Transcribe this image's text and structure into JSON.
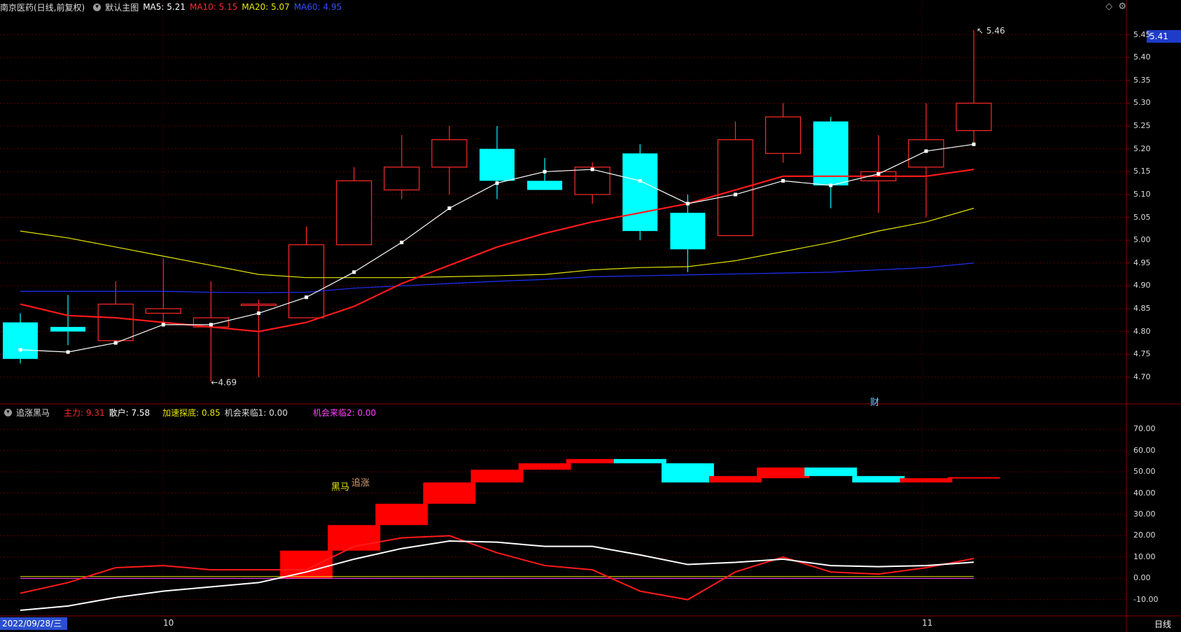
{
  "main_bar": {
    "stock": "南京医药(日线,前复权)",
    "indicator": "默认主图",
    "ma5": "MA5: 5.21",
    "ma10": "MA10: 5.15",
    "ma20": "MA20: 5.07",
    "ma60": "MA60: 4.95"
  },
  "sub_bar": {
    "name": "追涨黑马",
    "zhuli": "主力: 9.31",
    "sanhu": "散户: 7.58",
    "jiasu": "加速探底: 0.85",
    "jihui1": "机会来临1: 0.00",
    "jihui2": "机会来临2: 0.00"
  },
  "price_box": "5.41",
  "price_ticks": [
    "5.45",
    "5.40",
    "5.35",
    "5.30",
    "5.25",
    "5.20",
    "5.15",
    "5.10",
    "5.05",
    "5.00",
    "4.95",
    "4.90",
    "4.85",
    "4.80",
    "4.75",
    "4.70"
  ],
  "sub_ticks": [
    "70.00",
    "60.00",
    "50.00",
    "40.00",
    "30.00",
    "20.00",
    "10.00",
    "0.00",
    "-10.00"
  ],
  "annotations": {
    "high": "5.46",
    "low": "4.69",
    "heima": "黑马",
    "zhuizhang": "追涨",
    "cai": "财"
  },
  "x_axis": {
    "date": "2022/09/28/三",
    "oct": "10",
    "nov": "11",
    "period": "日线"
  },
  "colors": {
    "up": "#ff2a2a",
    "down": "#00ffff",
    "ma5": "#ffffff",
    "ma10": "#ff1a1a",
    "ma20": "#e6e600",
    "ma60": "#2030ff",
    "grid": "#5a0000"
  },
  "chart_data": [
    {
      "type": "candlestick",
      "title": "南京医药(日线,前复权)",
      "ylim": [
        4.66,
        5.48
      ],
      "candles": [
        {
          "o": 4.82,
          "h": 4.84,
          "l": 4.73,
          "c": 4.74
        },
        {
          "o": 4.81,
          "h": 4.88,
          "l": 4.77,
          "c": 4.8
        },
        {
          "o": 4.78,
          "h": 4.91,
          "l": 4.78,
          "c": 4.86
        },
        {
          "o": 4.84,
          "h": 4.96,
          "l": 4.81,
          "c": 4.85
        },
        {
          "o": 4.81,
          "h": 4.91,
          "l": 4.69,
          "c": 4.83
        },
        {
          "o": 4.86,
          "h": 4.87,
          "l": 4.7,
          "c": 4.86
        },
        {
          "o": 4.83,
          "h": 5.03,
          "l": 4.83,
          "c": 4.99
        },
        {
          "o": 4.99,
          "h": 5.16,
          "l": 4.99,
          "c": 5.13
        },
        {
          "o": 5.11,
          "h": 5.23,
          "l": 5.09,
          "c": 5.16
        },
        {
          "o": 5.16,
          "h": 5.25,
          "l": 5.1,
          "c": 5.22
        },
        {
          "o": 5.2,
          "h": 5.25,
          "l": 5.09,
          "c": 5.13
        },
        {
          "o": 5.13,
          "h": 5.18,
          "l": 5.11,
          "c": 5.11
        },
        {
          "o": 5.1,
          "h": 5.17,
          "l": 5.08,
          "c": 5.16
        },
        {
          "o": 5.19,
          "h": 5.21,
          "l": 5.0,
          "c": 5.02
        },
        {
          "o": 5.06,
          "h": 5.1,
          "l": 4.93,
          "c": 4.98
        },
        {
          "o": 5.01,
          "h": 5.26,
          "l": 5.01,
          "c": 5.22
        },
        {
          "o": 5.19,
          "h": 5.3,
          "l": 5.17,
          "c": 5.27
        },
        {
          "o": 5.26,
          "h": 5.27,
          "l": 5.07,
          "c": 5.12
        },
        {
          "o": 5.13,
          "h": 5.23,
          "l": 5.06,
          "c": 5.15
        },
        {
          "o": 5.16,
          "h": 5.3,
          "l": 5.05,
          "c": 5.22
        },
        {
          "o": 5.24,
          "h": 5.46,
          "l": 5.21,
          "c": 5.3
        }
      ],
      "ma5": [
        4.76,
        4.755,
        4.775,
        4.815,
        4.815,
        4.84,
        4.875,
        4.93,
        4.995,
        5.07,
        5.125,
        5.15,
        5.155,
        5.13,
        5.08,
        5.1,
        5.13,
        5.12,
        5.145,
        5.195,
        5.21
      ],
      "ma10": [
        4.86,
        4.835,
        4.83,
        4.82,
        4.81,
        4.8,
        4.82,
        4.855,
        4.905,
        4.945,
        4.985,
        5.015,
        5.04,
        5.06,
        5.08,
        5.11,
        5.14,
        5.14,
        5.14,
        5.14,
        5.155
      ],
      "ma20": [
        5.02,
        5.005,
        4.985,
        4.965,
        4.945,
        4.925,
        4.918,
        4.918,
        4.918,
        4.92,
        4.922,
        4.925,
        4.935,
        4.94,
        4.942,
        4.955,
        4.975,
        4.995,
        5.02,
        5.04,
        5.07
      ],
      "ma60": [
        4.888,
        4.888,
        4.888,
        4.888,
        4.886,
        4.885,
        4.886,
        4.895,
        4.9,
        4.905,
        4.91,
        4.914,
        4.92,
        4.922,
        4.924,
        4.926,
        4.928,
        4.93,
        4.935,
        4.94,
        4.95
      ]
    },
    {
      "type": "bar",
      "title": "追涨黑马",
      "ylim": [
        -15,
        75
      ],
      "blocks": [
        {
          "i": 5.5,
          "a": 0,
          "b": 13,
          "color": "red"
        },
        {
          "i": 6.5,
          "a": 13,
          "b": 25,
          "color": "red"
        },
        {
          "i": 7.5,
          "a": 25,
          "b": 35,
          "color": "red"
        },
        {
          "i": 8.5,
          "a": 35,
          "b": 45,
          "color": "red"
        },
        {
          "i": 9.5,
          "a": 45,
          "b": 51,
          "color": "red"
        },
        {
          "i": 10.5,
          "a": 51,
          "b": 54,
          "color": "red"
        },
        {
          "i": 11.5,
          "a": 54,
          "b": 56,
          "color": "red"
        },
        {
          "i": 12.5,
          "a": 54,
          "b": 56,
          "color": "cyan"
        },
        {
          "i": 13.5,
          "a": 45,
          "b": 54,
          "color": "cyan"
        },
        {
          "i": 14.5,
          "a": 45,
          "b": 48,
          "color": "red"
        },
        {
          "i": 15.5,
          "a": 47,
          "b": 52,
          "color": "red"
        },
        {
          "i": 16.5,
          "a": 48,
          "b": 52,
          "color": "cyan"
        },
        {
          "i": 17.5,
          "a": 45,
          "b": 48,
          "color": "cyan"
        },
        {
          "i": 18.5,
          "a": 45,
          "b": 47,
          "color": "red"
        },
        {
          "i": 19.5,
          "a": 47,
          "b": 47.5,
          "color": "red"
        }
      ],
      "zhuli": [
        -7,
        -2,
        5,
        6,
        4,
        4,
        15,
        19,
        20,
        12,
        6,
        4,
        -6,
        -10,
        3,
        10,
        3,
        2,
        5,
        9.31
      ],
      "sanhu": [
        -15,
        -13,
        -9,
        -6,
        -4,
        -2,
        3,
        9,
        14,
        17.5,
        17,
        15,
        15,
        11,
        6.5,
        7.5,
        9,
        6,
        5.5,
        6,
        7.58
      ],
      "baseline": 0.85
    }
  ]
}
